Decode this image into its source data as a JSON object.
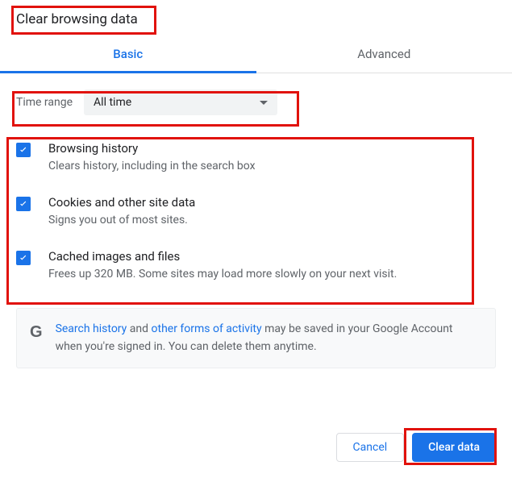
{
  "title": "Clear browsing data",
  "tabs": {
    "basic": "Basic",
    "advanced": "Advanced"
  },
  "timerange": {
    "label": "Time range",
    "value": "All time"
  },
  "options": [
    {
      "title": "Browsing history",
      "desc": "Clears history, including in the search box"
    },
    {
      "title": "Cookies and other site data",
      "desc": "Signs you out of most sites."
    },
    {
      "title": "Cached images and files",
      "desc": "Frees up 320 MB. Some sites may load more slowly on your next visit."
    }
  ],
  "notice": {
    "link1": "Search history",
    "text1": " and ",
    "link2": "other forms of activity",
    "text2": " may be saved in your Google Account when you're signed in. You can delete them anytime."
  },
  "actions": {
    "cancel": "Cancel",
    "clear": "Clear data"
  }
}
